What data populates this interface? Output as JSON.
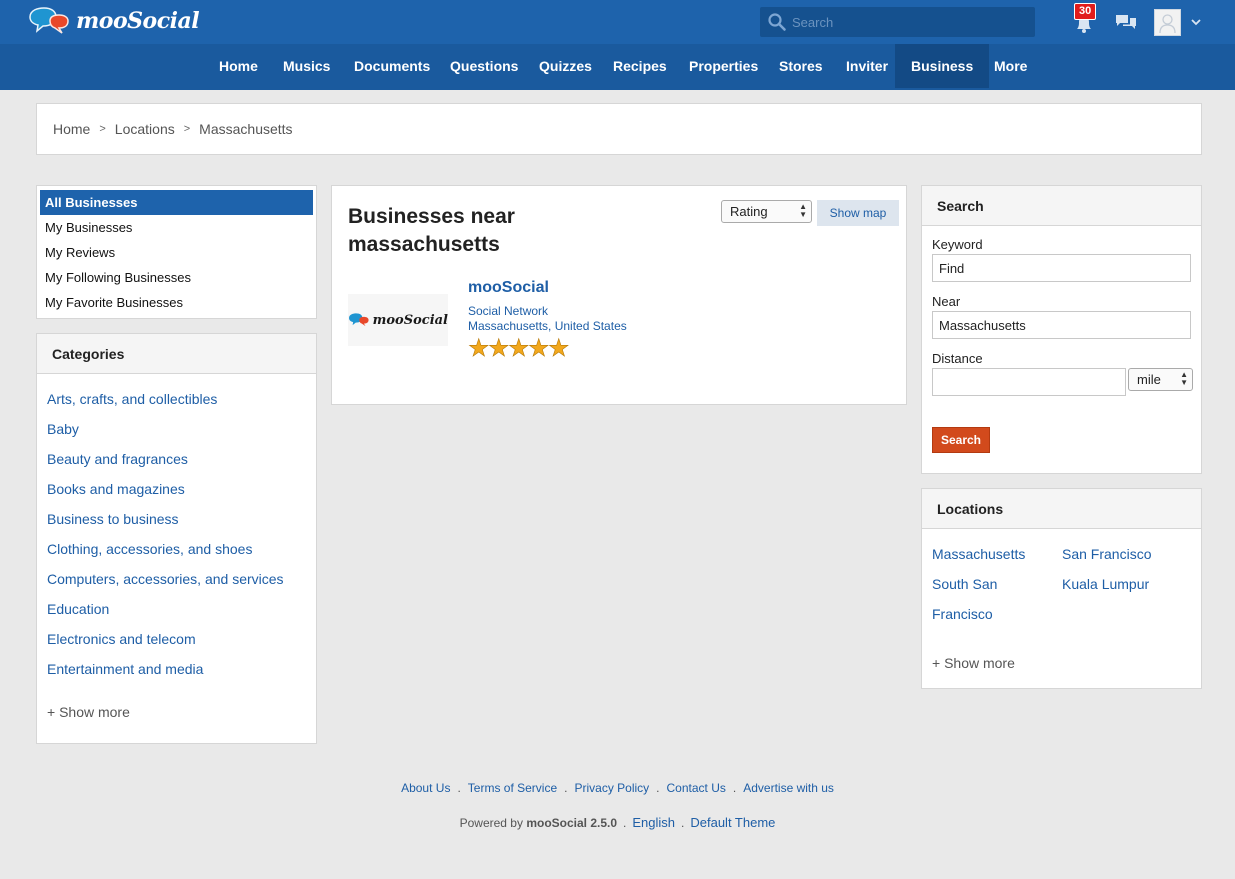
{
  "brand": {
    "name": "mooSocial"
  },
  "header": {
    "search_placeholder": "Search",
    "notification_count": "30"
  },
  "nav": {
    "items": [
      "Home",
      "Musics",
      "Documents",
      "Questions",
      "Quizzes",
      "Recipes",
      "Properties",
      "Stores",
      "Inviter",
      "Business",
      "More"
    ],
    "active": "Business"
  },
  "breadcrumb": [
    "Home",
    "Locations",
    "Massachusetts"
  ],
  "left": {
    "filters": [
      "All Businesses",
      "My Businesses",
      "My Reviews",
      "My Following Businesses",
      "My Favorite Businesses"
    ],
    "categories_title": "Categories",
    "categories": [
      "Arts, crafts, and collectibles",
      "Baby",
      "Beauty and fragrances",
      "Books and magazines",
      "Business to business",
      "Clothing, accessories, and shoes",
      "Computers, accessories, and services",
      "Education",
      "Electronics and telecom",
      "Entertainment and media"
    ],
    "show_more": "+ Show more"
  },
  "main": {
    "title": "Businesses near massachusetts",
    "sort_value": "Rating",
    "show_map_label": "Show map",
    "business": {
      "name": "mooSocial",
      "thumb_text": "mooSocial",
      "category": "Social Network",
      "location": "Massachusetts, United States",
      "rating": 5,
      "rating_max": 5
    }
  },
  "search_panel": {
    "title": "Search",
    "keyword_label": "Keyword",
    "keyword_value": "Find",
    "near_label": "Near",
    "near_value": "Massachusetts",
    "distance_label": "Distance",
    "distance_value": "",
    "unit_value": "mile",
    "button": "Search"
  },
  "locations_panel": {
    "title": "Locations",
    "items": [
      "Massachusetts",
      "San Francisco",
      "South San",
      "Francisco",
      "Kuala Lumpur"
    ],
    "show_more": "+ Show more"
  },
  "footer": {
    "links": [
      "About Us",
      "Terms of Service",
      "Privacy Policy",
      "Contact Us",
      "Advertise with us"
    ],
    "powered_prefix": "Powered by",
    "powered_brand": "mooSocial 2.5.0",
    "language": "English",
    "theme": "Default Theme"
  }
}
